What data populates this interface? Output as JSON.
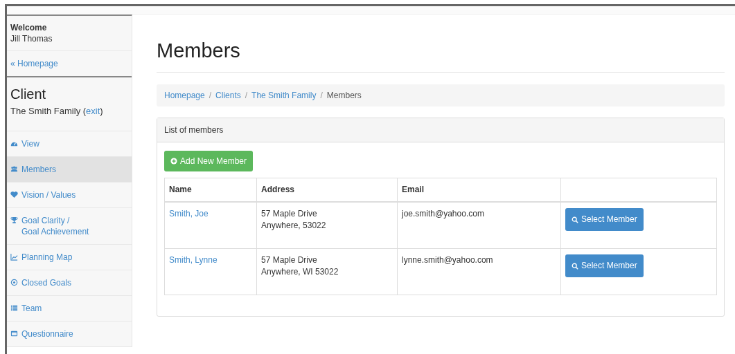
{
  "sidebar": {
    "welcome": "Welcome",
    "user": "Jill Thomas",
    "home_link": "« Homepage",
    "section_title": "Client",
    "client_name": "The Smith Family",
    "paren_open": "(",
    "exit_link": "exit",
    "paren_close": ")",
    "items": [
      {
        "label": "View",
        "selected": false
      },
      {
        "label": "Members",
        "selected": true
      },
      {
        "label": "Vision / Values",
        "selected": false
      },
      {
        "label": "Goal Clarity /",
        "label_2": "Goal Achievement",
        "selected": false
      },
      {
        "label": "Planning Map",
        "selected": false
      },
      {
        "label": "Closed Goals",
        "selected": false
      },
      {
        "label": "Team",
        "selected": false
      },
      {
        "label": "Questionnaire",
        "selected": false
      }
    ]
  },
  "page_title": "Members",
  "breadcrumb": [
    {
      "label": "Homepage",
      "link": true,
      "separator": "/"
    },
    {
      "label": "Clients",
      "link": true,
      "separator": "/"
    },
    {
      "label": "The Smith Family",
      "link": true,
      "separator": "/"
    },
    {
      "label": "Members",
      "link": false
    }
  ],
  "panel": {
    "title": "List of members",
    "add_button": "Add New Member",
    "table": {
      "columns": [
        "Name",
        "Address",
        "Email"
      ],
      "rows": [
        {
          "name": "Smith, Joe",
          "address_1": "57 Maple Drive",
          "address_2": "Anywhere, 53022",
          "email": "joe.smith@yahoo.com",
          "action": "Select Member"
        },
        {
          "name": "Smith, Lynne",
          "address_1": "57 Maple Drive",
          "address_2": "Anywhere, WI 53022",
          "email": "lynne.smith@yahoo.com",
          "action": "Select Member"
        }
      ]
    }
  }
}
